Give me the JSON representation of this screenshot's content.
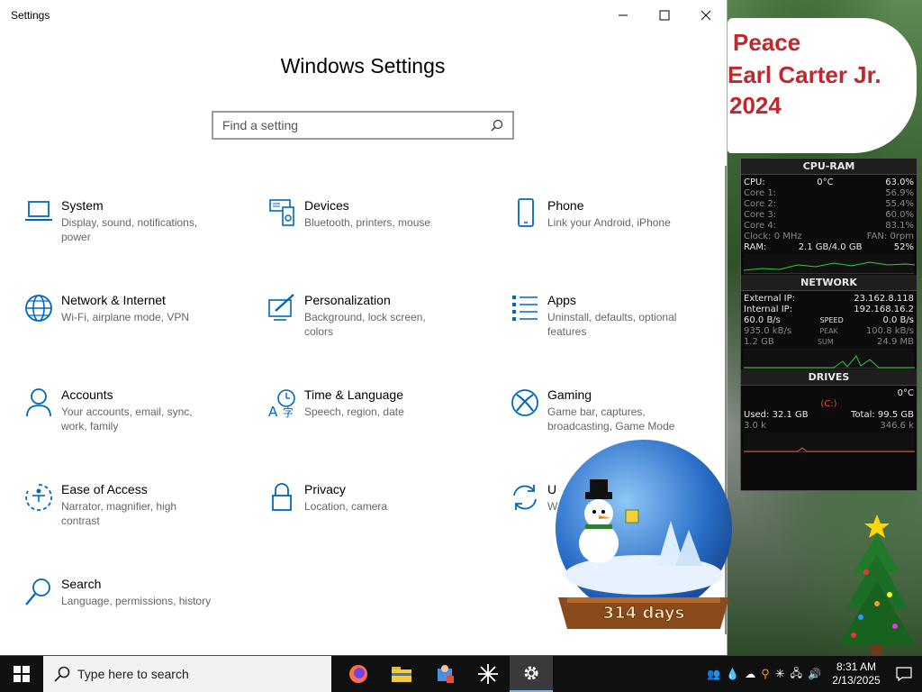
{
  "window": {
    "title": "Settings",
    "heading": "Windows Settings",
    "search_placeholder": "Find a setting"
  },
  "tiles": [
    {
      "name": "System",
      "desc": "Display, sound, notifications, power",
      "icon": "laptop-icon"
    },
    {
      "name": "Devices",
      "desc": "Bluetooth, printers, mouse",
      "icon": "devices-icon"
    },
    {
      "name": "Phone",
      "desc": "Link your Android, iPhone",
      "icon": "phone-icon"
    },
    {
      "name": "Network & Internet",
      "desc": "Wi-Fi, airplane mode, VPN",
      "icon": "globe-icon"
    },
    {
      "name": "Personalization",
      "desc": "Background, lock screen, colors",
      "icon": "paint-icon"
    },
    {
      "name": "Apps",
      "desc": "Uninstall, defaults, optional features",
      "icon": "apps-list-icon"
    },
    {
      "name": "Accounts",
      "desc": "Your accounts, email, sync, work, family",
      "icon": "person-icon"
    },
    {
      "name": "Time & Language",
      "desc": "Speech, region, date",
      "icon": "time-language-icon"
    },
    {
      "name": "Gaming",
      "desc": "Game bar, captures, broadcasting, Game Mode",
      "icon": "xbox-icon"
    },
    {
      "name": "Ease of Access",
      "desc": "Narrator, magnifier, high contrast",
      "icon": "ease-of-access-icon"
    },
    {
      "name": "Privacy",
      "desc": "Location, camera",
      "icon": "lock-icon"
    },
    {
      "name": "U",
      "desc": "W",
      "icon": "update-icon"
    },
    {
      "name": "Search",
      "desc": "Language, permissions, history",
      "icon": "search-icon"
    }
  ],
  "banner": {
    "line1": "Peace",
    "line2": "Earl Carter Jr.",
    "line3": "2024"
  },
  "globe": {
    "label": "314 days"
  },
  "monitor": {
    "cpu_title": "CPU-RAM",
    "cpu_label": "CPU:",
    "cpu_temp": "0°C",
    "cpu_value": "63.0%",
    "cores": [
      {
        "label": "Core 1:",
        "value": "56.9%"
      },
      {
        "label": "Core 2:",
        "value": "55.4%"
      },
      {
        "label": "Core 3:",
        "value": "60.0%"
      },
      {
        "label": "Core 4:",
        "value": "83.1%"
      }
    ],
    "clock_label": "Clock: 0 MHz",
    "fan_label": "FAN: 0rpm",
    "ram_label": "RAM:",
    "ram_value": "2.1 GB/4.0 GB",
    "ram_percent": "52%",
    "net_title": "NETWORK",
    "external_ip_label": "External IP:",
    "external_ip": "23.162.8.118",
    "internal_ip_label": "Internal IP:",
    "internal_ip": "192.168.16.2",
    "speed_left": "60.0 B/s",
    "speed_label": "SPEED",
    "speed_right": "0.0 B/s",
    "peak_left": "935.0 kB/s",
    "peak_label": "PEAK",
    "peak_right": "100.8 kB/s",
    "sum_left": "1.2 GB",
    "sum_label": "SUM",
    "sum_right": "24.9 MB",
    "drives_title": "DRIVES",
    "drive_temp": "0°C",
    "drive_name": "(C:)",
    "used": "Used: 32.1 GB",
    "total": "Total: 99.5 GB",
    "read": "3.0 k",
    "write": "346.6 k"
  },
  "taskbar": {
    "search_text": "Type here to search",
    "time": "8:31 AM",
    "date": "2/13/2025"
  },
  "colors": {
    "accent": "#0067c0",
    "monitor_green": "#33cc33"
  }
}
